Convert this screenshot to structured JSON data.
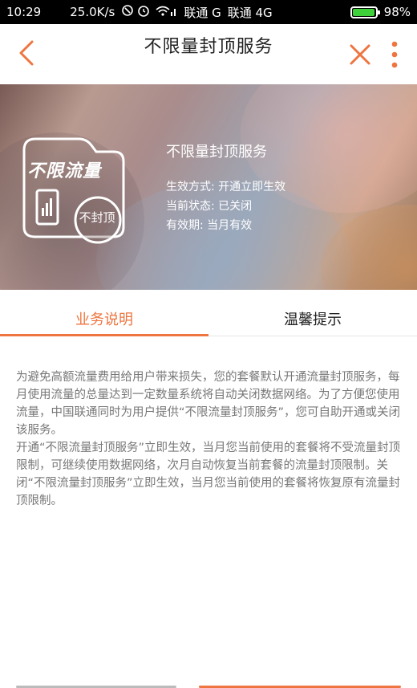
{
  "status_bar": {
    "time": "10:29",
    "speed": "25.0K/s",
    "carrier1": "联通 G",
    "carrier2": "联通 4G",
    "battery": "98%",
    "battery_level": 0.98
  },
  "header": {
    "title": "不限量封顶服务",
    "accent_color": "#ee7540"
  },
  "banner": {
    "logo_main": "不限流量",
    "logo_sub": "不封顶",
    "service_name": "不限量封顶服务",
    "rows": [
      "生效方式: 开通立即生效",
      "当前状态: 已关闭",
      "有效期: 当月有效"
    ]
  },
  "tabs": [
    {
      "label": "业务说明",
      "active": true
    },
    {
      "label": "温馨提示",
      "active": false
    }
  ],
  "description": [
    "为避免高额流量费用给用户带来损失，您的套餐默认开通流量封顶服务，每月使用流量的总量达到一定数量系统将自动关闭数据网络。为了方便您使用流量，中国联通同时为用户提供“不限流量封顶服务”，您可自助开通或关闭该服务。",
    "开通“不限流量封顶服务”立即生效，当月您当前使用的套餐将不受流量封顶限制，可继续使用数据网络，次月自动恢复当前套餐的流量封顶限制。关闭“不限流量封顶服务”立即生效，当月您当前使用的套餐将恢复原有流量封顶限制。"
  ]
}
